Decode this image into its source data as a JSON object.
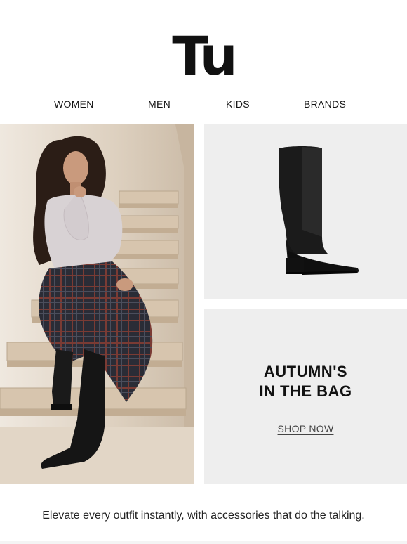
{
  "brand": {
    "logo_text": "Tu"
  },
  "nav": {
    "items": [
      {
        "label": "WOMEN"
      },
      {
        "label": "MEN"
      },
      {
        "label": "KIDS"
      },
      {
        "label": "BRANDS"
      }
    ]
  },
  "hero": {
    "headline_line1": "AUTUMN'S",
    "headline_line2": "IN THE BAG",
    "cta_label": "SHOP NOW"
  },
  "tagline": "Elevate every outfit instantly, with accessories that do the talking.",
  "colors": {
    "panel_bg": "#eeeeee",
    "text": "#111111",
    "link": "#444444"
  },
  "images": {
    "left_photo": "model-on-stairs-photo",
    "product_photo": "black-knee-high-boot"
  }
}
